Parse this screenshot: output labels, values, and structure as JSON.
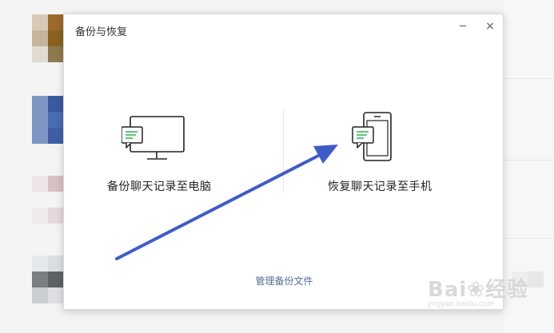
{
  "dialog": {
    "title": "备份与恢复",
    "minimize_icon": "minimize-icon",
    "close_icon": "close-icon",
    "close_glyph": "×"
  },
  "options": {
    "backup": {
      "label": "备份聊天记录至电脑",
      "icon": "monitor-chat-icon"
    },
    "restore": {
      "label": "恢复聊天记录至手机",
      "icon": "phone-chat-icon"
    }
  },
  "footer": {
    "manage_link": "管理备份文件"
  },
  "watermark": {
    "text": "Bai",
    "text_end": "经验",
    "sub": "jingyan.baidu.com"
  },
  "colors": {
    "link": "#576b95",
    "arrow": "#3f5bc8",
    "chat_green": "#2bb24c"
  }
}
